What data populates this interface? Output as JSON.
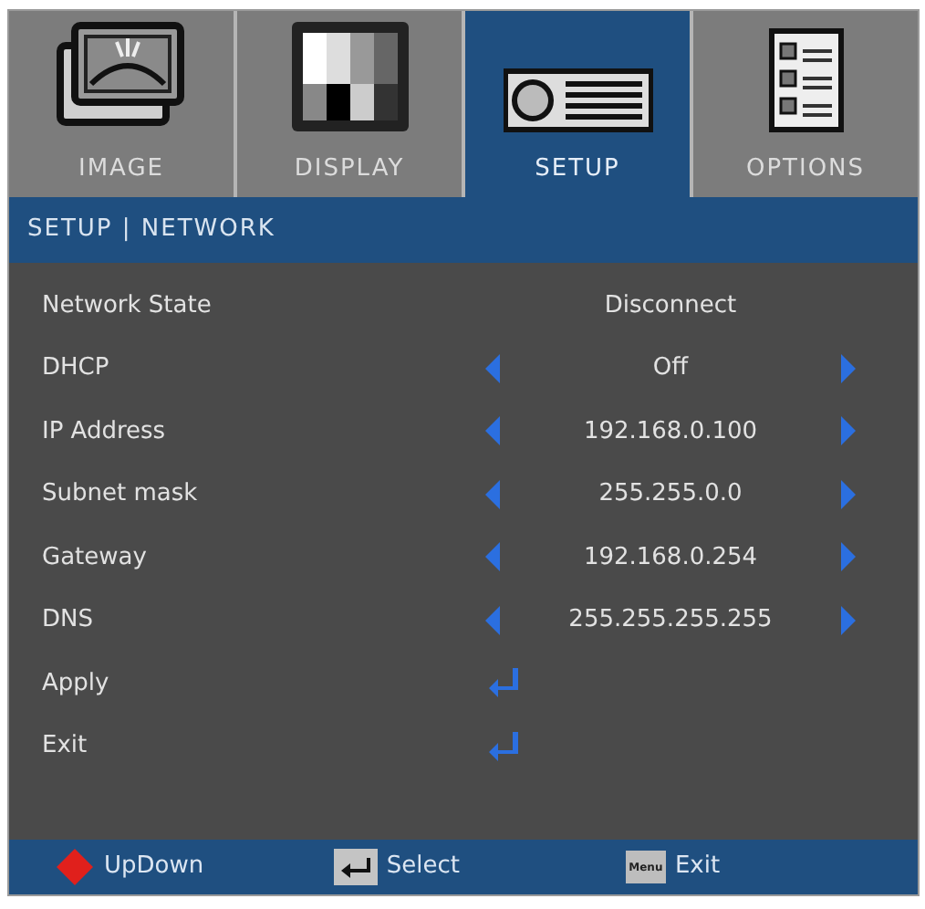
{
  "tabs": [
    {
      "label": "IMAGE",
      "selected": false
    },
    {
      "label": "DISPLAY",
      "selected": false
    },
    {
      "label": "SETUP",
      "selected": true
    },
    {
      "label": "OPTIONS",
      "selected": false
    }
  ],
  "breadcrumb": "SETUP | NETWORK",
  "items": [
    {
      "kind": "info",
      "label": "Network State",
      "value": "Disconnect"
    },
    {
      "kind": "choice",
      "label": "DHCP",
      "value": "Off"
    },
    {
      "kind": "choice",
      "label": "IP Address",
      "value": "192.168.0.100"
    },
    {
      "kind": "choice",
      "label": "Subnet mask",
      "value": "255.255.0.0"
    },
    {
      "kind": "choice",
      "label": "Gateway",
      "value": "192.168.0.254"
    },
    {
      "kind": "choice",
      "label": "DNS",
      "value": "255.255.255.255"
    },
    {
      "kind": "action",
      "label": "Apply"
    },
    {
      "kind": "action",
      "label": "Exit"
    }
  ],
  "footer": [
    {
      "kind": "updown",
      "label": "UpDown"
    },
    {
      "kind": "enter",
      "label": "Select"
    },
    {
      "kind": "menu",
      "label": "Exit",
      "key_label": "Menu"
    }
  ]
}
